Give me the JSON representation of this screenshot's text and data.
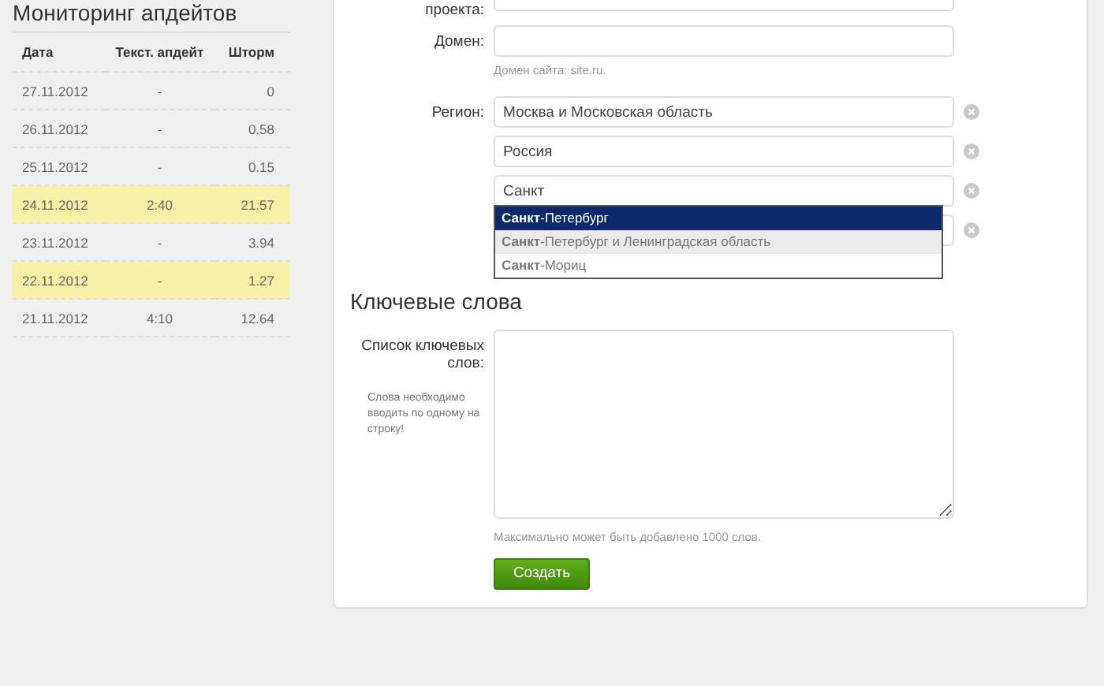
{
  "sidebar": {
    "title": "Мониторинг апдейтов",
    "table": {
      "columns": [
        "Дата",
        "Текст. апдейт",
        "Шторм"
      ],
      "rows": [
        {
          "cells": [
            "27.11.2012",
            "-",
            "0"
          ],
          "highlighted": false
        },
        {
          "cells": [
            "26.11.2012",
            "-",
            "0.58"
          ],
          "highlighted": false
        },
        {
          "cells": [
            "25.11.2012",
            "-",
            "0.15"
          ],
          "highlighted": false
        },
        {
          "cells": [
            "24.11.2012",
            "2:40",
            "21.57"
          ],
          "highlighted": true
        },
        {
          "cells": [
            "23.11.2012",
            "-",
            "3.94"
          ],
          "highlighted": false
        },
        {
          "cells": [
            "22.11.2012",
            "-",
            "1.27"
          ],
          "highlighted": true
        },
        {
          "cells": [
            "21.11.2012",
            "4:10",
            "12.64"
          ],
          "highlighted": false
        }
      ]
    }
  },
  "form": {
    "project_label": "проекта:",
    "domain": {
      "label": "Домен:",
      "hint": "Домен сайта: site.ru."
    },
    "region": {
      "label": "Регион:",
      "fields": [
        {
          "value": "Москва и Московская область",
          "removable": true
        },
        {
          "value": "Россия",
          "removable": true
        },
        {
          "value": "Санкт",
          "removable": true
        },
        {
          "removable": true
        }
      ],
      "suggestions": [
        {
          "text": "**Санкт**-Петербург",
          "selected": true,
          "hovered": false
        },
        {
          "text": "**Санкт**-Петербург и Ленинградская область",
          "selected": false,
          "hovered": true
        },
        {
          "text": "**Санкт**-Мориц",
          "selected": false,
          "hovered": false
        }
      ]
    },
    "keywords": {
      "heading": "Ключевые слова",
      "label": "Список ключевых слов:",
      "note": "Слова необходимо вводить по одному на строку!",
      "hint": "Максимально может быть добавлено 1000 слов.",
      "button": "Создать"
    }
  }
}
